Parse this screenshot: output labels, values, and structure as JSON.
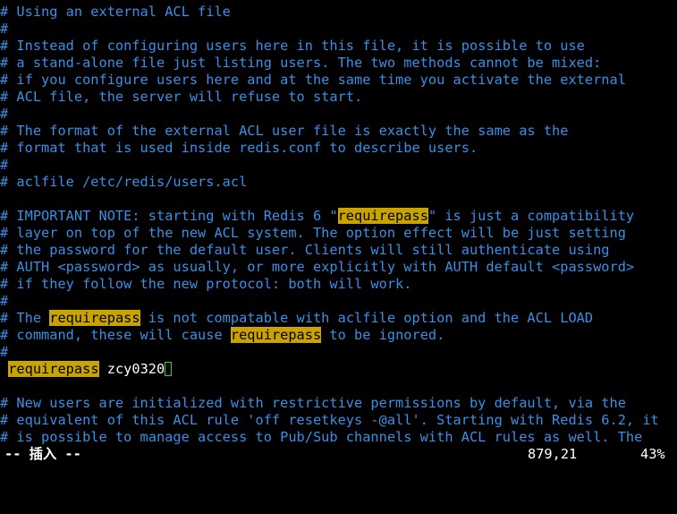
{
  "editor": {
    "lines": [
      {
        "segments": [
          {
            "t": "# Using an external ACL file",
            "k": "cm"
          }
        ]
      },
      {
        "segments": [
          {
            "t": "#",
            "k": "cm"
          }
        ]
      },
      {
        "segments": [
          {
            "t": "# Instead of configuring users here in this file, it is possible to use",
            "k": "cm"
          }
        ]
      },
      {
        "segments": [
          {
            "t": "# a stand-alone file just listing users. The two methods cannot be mixed:",
            "k": "cm"
          }
        ]
      },
      {
        "segments": [
          {
            "t": "# if you configure users here and at the same time you activate the external",
            "k": "cm"
          }
        ]
      },
      {
        "segments": [
          {
            "t": "# ACL file, the server will refuse to start.",
            "k": "cm"
          }
        ]
      },
      {
        "segments": [
          {
            "t": "#",
            "k": "cm"
          }
        ]
      },
      {
        "segments": [
          {
            "t": "# The format of the external ACL user file is exactly the same as the",
            "k": "cm"
          }
        ]
      },
      {
        "segments": [
          {
            "t": "# format that is used inside redis.conf to describe users.",
            "k": "cm"
          }
        ]
      },
      {
        "segments": [
          {
            "t": "#",
            "k": "cm"
          }
        ]
      },
      {
        "segments": [
          {
            "t": "# aclfile /etc/redis/users.acl",
            "k": "cm"
          }
        ]
      },
      {
        "segments": [
          {
            "t": "",
            "k": "cm"
          }
        ]
      },
      {
        "segments": [
          {
            "t": "# IMPORTANT NOTE: starting with Redis 6 \"",
            "k": "cm"
          },
          {
            "t": "requirepass",
            "k": "hl"
          },
          {
            "t": "\" is just a compatibility",
            "k": "cm"
          }
        ]
      },
      {
        "segments": [
          {
            "t": "# layer on top of the new ACL system. The option effect will be just setting",
            "k": "cm"
          }
        ]
      },
      {
        "segments": [
          {
            "t": "# the password for the default user. Clients will still authenticate using",
            "k": "cm"
          }
        ]
      },
      {
        "segments": [
          {
            "t": "# AUTH <password> as usually, or more explicitly with AUTH default <password>",
            "k": "cm"
          }
        ]
      },
      {
        "segments": [
          {
            "t": "# if they follow the new protocol: both will work.",
            "k": "cm"
          }
        ]
      },
      {
        "segments": [
          {
            "t": "#",
            "k": "cm"
          }
        ]
      },
      {
        "segments": [
          {
            "t": "# The ",
            "k": "cm"
          },
          {
            "t": "requirepass",
            "k": "hl"
          },
          {
            "t": " is not compatable with aclfile option and the ACL LOAD",
            "k": "cm"
          }
        ]
      },
      {
        "segments": [
          {
            "t": "# command, these will cause ",
            "k": "cm"
          },
          {
            "t": "requirepass",
            "k": "hl"
          },
          {
            "t": " to be ignored.",
            "k": "cm"
          }
        ]
      },
      {
        "segments": [
          {
            "t": "#",
            "k": "cm"
          }
        ]
      },
      {
        "segments": [
          {
            "t": " ",
            "k": "normal"
          },
          {
            "t": "requirepass",
            "k": "hl"
          },
          {
            "t": " zcy0320",
            "k": "normal"
          },
          {
            "t": "",
            "k": "cursor"
          }
        ]
      },
      {
        "segments": [
          {
            "t": "",
            "k": "cm"
          }
        ]
      },
      {
        "segments": [
          {
            "t": "# New users are initialized with restrictive permissions by default, via the",
            "k": "cm"
          }
        ]
      },
      {
        "segments": [
          {
            "t": "# equivalent of this ACL rule 'off resetkeys -@all'. Starting with Redis 6.2, it",
            "k": "cm"
          }
        ]
      },
      {
        "segments": [
          {
            "t": "# is possible to manage access to Pub/Sub channels with ACL rules as well. The",
            "k": "cm"
          }
        ]
      }
    ]
  },
  "status": {
    "mode": "-- 插入 --",
    "position": "879,21",
    "percent": "43%"
  },
  "colors": {
    "background": "#000000",
    "comment": "#3a8fe6",
    "highlight_bg": "#c9a400",
    "normal_text": "#ffffff",
    "cursor": "#2ad12a"
  }
}
